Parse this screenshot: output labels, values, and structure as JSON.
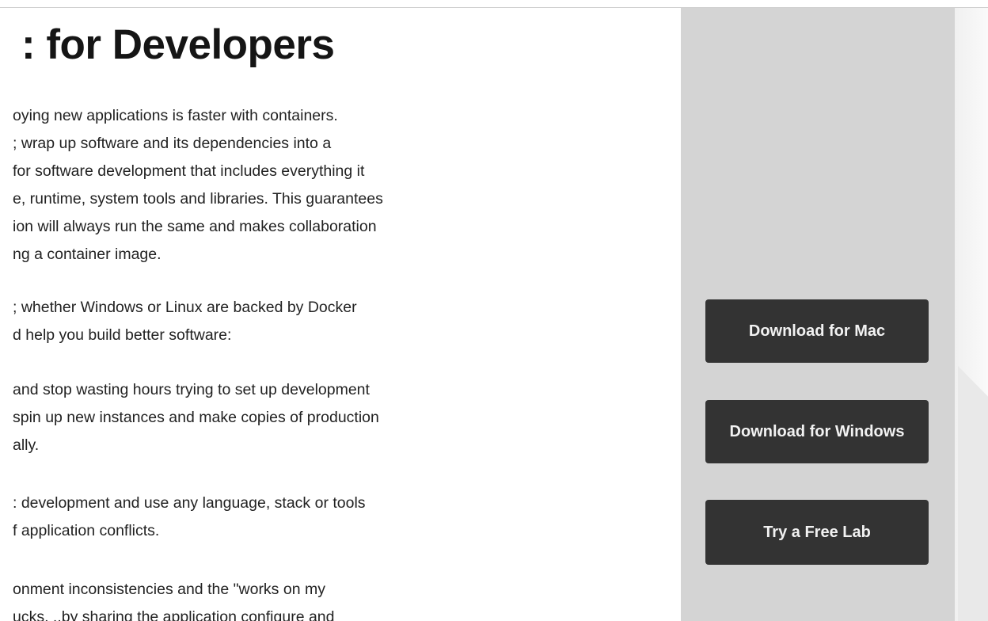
{
  "page": {
    "title": ": for Developers",
    "paragraphs": [
      [
        "oying new applications is faster with containers.",
        "; wrap up software and its dependencies into a",
        " for software development that includes everything it",
        "e, runtime, system tools and libraries. This guarantees",
        "ion will always run the same and makes collaboration",
        "ng a container image."
      ],
      [
        "; whether Windows or Linux are backed by Docker",
        "d help you build better software:"
      ],
      [
        " and stop wasting hours trying to set up development",
        "spin up new instances and make copies of production",
        "ally."
      ],
      [
        ": development and use any language, stack or tools",
        "f application conflicts."
      ],
      [
        "onment inconsistencies and the \"works on my",
        "ucks.  ..by  sharing  the  application  configure  and"
      ]
    ]
  },
  "sidebar": {
    "buttons": {
      "mac": "Download for Mac",
      "windows": "Download for Windows",
      "lab": "Try a Free Lab"
    }
  },
  "colors": {
    "button_bg": "#333333",
    "sidebar_bg": "#d4d4d4",
    "text": "#222222"
  }
}
